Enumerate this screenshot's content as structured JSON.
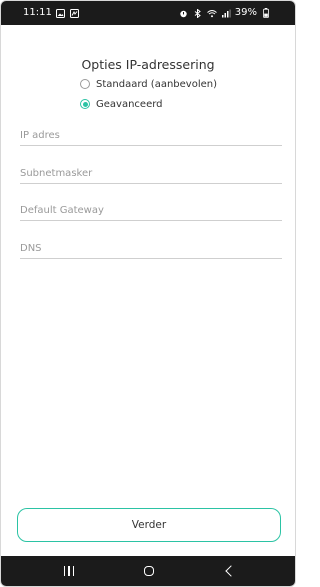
{
  "status_bar": {
    "time": "11:11",
    "battery": "39%",
    "left_icons": [
      "gallery-icon",
      "missed-call-icon"
    ],
    "right_icons": [
      "alarm-icon",
      "bluetooth-icon",
      "wifi-icon",
      "signal-icon",
      "battery-icon"
    ]
  },
  "screen": {
    "title": "Opties IP-adressering",
    "radio_options": [
      {
        "label": "Standaard (aanbevolen)",
        "checked": false
      },
      {
        "label": "Geavanceerd",
        "checked": true
      }
    ],
    "fields": [
      {
        "placeholder": "IP adres",
        "value": ""
      },
      {
        "placeholder": "Subnetmasker",
        "value": ""
      },
      {
        "placeholder": "Default Gateway",
        "value": ""
      },
      {
        "placeholder": "DNS",
        "value": ""
      }
    ],
    "next_button": "Verder"
  },
  "nav_bar": {
    "icons": [
      "recents-icon",
      "home-icon",
      "back-icon"
    ]
  },
  "colors": {
    "accent": "#2bc3a4",
    "bar_background": "#1b1b1b",
    "text": "#333333",
    "placeholder": "#9a9a9a"
  }
}
